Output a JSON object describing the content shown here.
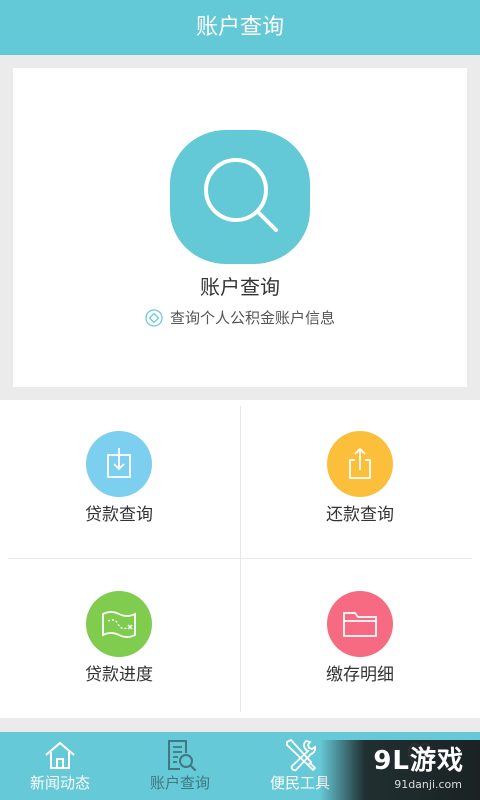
{
  "header": {
    "title": "账户查询"
  },
  "hero": {
    "icon": "search-icon",
    "title": "账户查询",
    "subtitle_icon": "diamond-icon",
    "subtitle": "查询个人公积金账户信息"
  },
  "grid": {
    "items": [
      {
        "label": "贷款查询",
        "icon": "download-icon",
        "color": "#7ccfee"
      },
      {
        "label": "还款查询",
        "icon": "upload-icon",
        "color": "#fbbf3c"
      },
      {
        "label": "贷款进度",
        "icon": "map-icon",
        "color": "#80cc4e"
      },
      {
        "label": "缴存明细",
        "icon": "folder-icon",
        "color": "#f66b82"
      }
    ]
  },
  "nav": {
    "items": [
      {
        "label": "新闻动态",
        "icon": "home-icon",
        "active": false
      },
      {
        "label": "账户查询",
        "icon": "document-search-icon",
        "active": true
      },
      {
        "label": "便民工具",
        "icon": "tools-icon",
        "active": false
      },
      {
        "icon": "heart-icon",
        "active": false
      }
    ]
  },
  "watermark": {
    "logo": "9L游戏",
    "site": "91danji.com"
  },
  "colors": {
    "primary": "#63c9d6",
    "nav_background": "#66c9d7",
    "nav_active": "#3f7880",
    "page_background": "#ebebeb"
  }
}
